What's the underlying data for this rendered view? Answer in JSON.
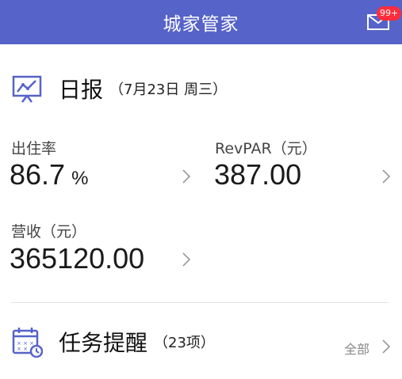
{
  "header": {
    "title": "城家管家",
    "badge": "99+",
    "mail_icon": "mail-icon"
  },
  "report": {
    "title": "日报",
    "date": "（7月23日 周三）",
    "occupancy_label": "出住率",
    "occupancy_value": "86.7",
    "occupancy_unit": "%",
    "revpar_label": "RevPAR（元）",
    "revpar_value": "387.00",
    "revenue_label": "营收（元）",
    "revenue_value": "365120.00"
  },
  "tasks": {
    "title": "任务提醒",
    "count": "（23项）",
    "all_label": "全部"
  },
  "colors": {
    "header_bg": "#5663c8",
    "badge_bg": "#ff2d3c"
  }
}
